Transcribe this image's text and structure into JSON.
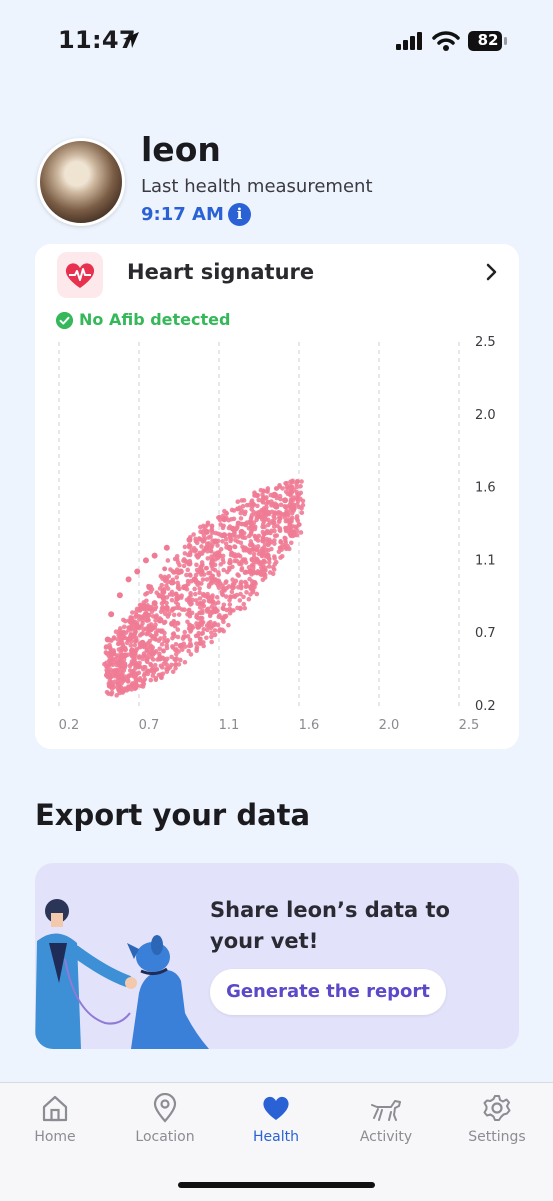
{
  "status_bar": {
    "time": "11:47",
    "battery": "82"
  },
  "profile": {
    "pet_name": "leon",
    "last_label": "Last health measurement",
    "last_time": "9:17 AM"
  },
  "heart_card": {
    "title": "Heart signature",
    "status": "No Afib detected"
  },
  "chart_data": {
    "type": "scatter",
    "title": "",
    "xlabel": "",
    "ylabel": "",
    "x_ticks": [
      "0.2",
      "0.7",
      "1.1",
      "1.6",
      "2.0",
      "2.5"
    ],
    "y_ticks": [
      "2.5",
      "2.0",
      "1.6",
      "1.1",
      "0.7",
      "0.2"
    ],
    "xlim": [
      0.2,
      2.5
    ],
    "ylim": [
      0.2,
      2.5
    ],
    "grid": "vertical dashed",
    "point_color": "#f07b95",
    "points": [
      [
        0.52,
        0.42
      ],
      [
        0.55,
        0.48
      ],
      [
        0.58,
        0.52
      ],
      [
        0.6,
        0.62
      ],
      [
        0.62,
        0.55
      ],
      [
        0.65,
        0.7
      ],
      [
        0.68,
        0.6
      ],
      [
        0.7,
        0.78
      ],
      [
        0.72,
        0.68
      ],
      [
        0.75,
        0.85
      ],
      [
        0.78,
        0.74
      ],
      [
        0.8,
        0.92
      ],
      [
        0.82,
        0.82
      ],
      [
        0.85,
        0.98
      ],
      [
        0.88,
        0.88
      ],
      [
        0.9,
        1.05
      ],
      [
        0.92,
        0.95
      ],
      [
        0.95,
        1.1
      ],
      [
        0.98,
        1.0
      ],
      [
        1.0,
        1.15
      ],
      [
        1.02,
        1.05
      ],
      [
        1.05,
        1.2
      ],
      [
        1.08,
        1.1
      ],
      [
        1.1,
        1.24
      ],
      [
        1.12,
        1.15
      ],
      [
        1.15,
        1.28
      ],
      [
        1.18,
        1.2
      ],
      [
        1.2,
        1.32
      ],
      [
        1.25,
        1.3
      ],
      [
        1.3,
        1.36
      ],
      [
        1.35,
        1.4
      ],
      [
        1.4,
        1.42
      ],
      [
        1.45,
        1.46
      ],
      [
        1.5,
        1.5
      ],
      [
        1.55,
        1.45
      ],
      [
        0.6,
        1.0
      ],
      [
        0.65,
        1.05
      ],
      [
        0.7,
        1.12
      ],
      [
        0.75,
        1.15
      ],
      [
        0.82,
        1.2
      ],
      [
        0.55,
        0.9
      ],
      [
        0.5,
        0.78
      ],
      [
        0.48,
        0.62
      ],
      [
        0.66,
        0.45
      ],
      [
        0.78,
        0.5
      ],
      [
        0.9,
        0.58
      ],
      [
        1.0,
        0.7
      ],
      [
        1.1,
        0.8
      ],
      [
        1.2,
        0.95
      ],
      [
        1.3,
        1.05
      ],
      [
        1.4,
        1.15
      ],
      [
        0.95,
        1.25
      ],
      [
        1.05,
        1.3
      ],
      [
        1.15,
        1.38
      ],
      [
        0.72,
        0.95
      ],
      [
        0.85,
        0.72
      ]
    ]
  },
  "export": {
    "title": "Export your data",
    "promo_text": "Share leon’s data to your vet!",
    "button_label": "Generate the report"
  },
  "tab_bar": {
    "items": [
      {
        "label": "Home",
        "icon": "home-icon"
      },
      {
        "label": "Location",
        "icon": "location-pin-icon"
      },
      {
        "label": "Health",
        "icon": "heart-icon"
      },
      {
        "label": "Activity",
        "icon": "dog-icon"
      },
      {
        "label": "Settings",
        "icon": "gear-icon"
      }
    ],
    "active": "Health"
  },
  "colors": {
    "accent": "#2a62d6",
    "success": "#35b85a",
    "heart": "#e8314f",
    "scatter": "#f07b95",
    "promo_bg": "#e3e2fb",
    "button_text": "#5b49c9"
  }
}
